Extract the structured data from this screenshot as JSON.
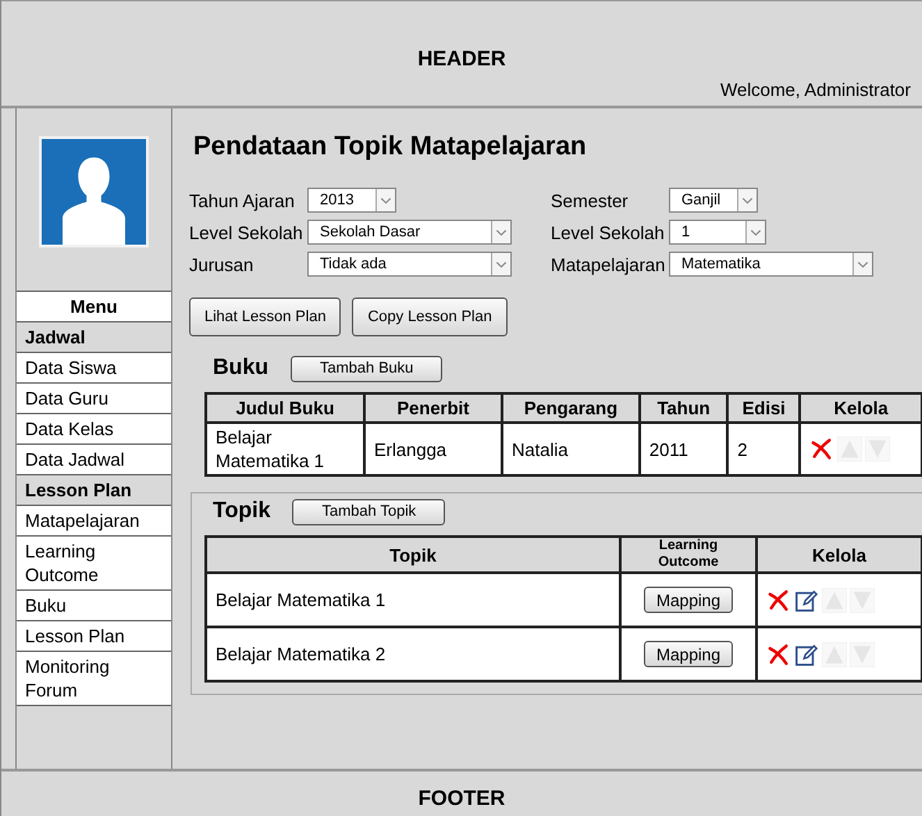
{
  "header": {
    "title": "HEADER",
    "welcome": "Welcome, Administrator"
  },
  "sidebar": {
    "menu": [
      {
        "kind": "title",
        "label": "Menu"
      },
      {
        "kind": "section",
        "label": "Jadwal"
      },
      {
        "kind": "item",
        "label": "Data Siswa"
      },
      {
        "kind": "item",
        "label": "Data Guru"
      },
      {
        "kind": "item",
        "label": "Data Kelas"
      },
      {
        "kind": "item",
        "label": "Data Jadwal"
      },
      {
        "kind": "section",
        "label": "Lesson Plan"
      },
      {
        "kind": "item",
        "label": "Matapelajaran"
      },
      {
        "kind": "item",
        "label": "Learning Outcome"
      },
      {
        "kind": "item",
        "label": "Buku"
      },
      {
        "kind": "item",
        "label": "Lesson Plan"
      },
      {
        "kind": "item",
        "label": "Monitoring Forum"
      }
    ]
  },
  "page_title": "Pendataan Topik Matapelajaran",
  "form": {
    "columns": [
      [
        {
          "label": "Tahun Ajaran",
          "value": "2013"
        },
        {
          "label": "Level Sekolah",
          "value": "Sekolah Dasar"
        },
        {
          "label": "Jurusan",
          "value": "Tidak ada"
        }
      ],
      [
        {
          "label": "Semester",
          "value": "Ganjil"
        },
        {
          "label": "Level Sekolah",
          "value": "1"
        },
        {
          "label": "Matapelajaran",
          "value": "Matematika"
        }
      ]
    ],
    "buttons": [
      "Lihat Lesson Plan",
      "Copy Lesson Plan"
    ]
  },
  "buku": {
    "title": "Buku",
    "add_button": "Tambah Buku",
    "columns": [
      "Judul Buku",
      "Penerbit",
      "Pengarang",
      "Tahun",
      "Edisi",
      "Kelola"
    ],
    "rows": [
      {
        "cells": [
          "Belajar Matematika 1",
          "Erlangga",
          "Natalia",
          "2011",
          "2"
        ],
        "actions": [
          {
            "kind": "delete",
            "disabled": false
          },
          {
            "kind": "up",
            "disabled": true
          },
          {
            "kind": "down",
            "disabled": true
          }
        ]
      }
    ]
  },
  "topik": {
    "title": "Topik",
    "add_button": "Tambah Topik",
    "columns": [
      "Topik",
      "Learning Outcome",
      "Kelola"
    ],
    "rows": [
      {
        "topik": "Belajar Matematika 1",
        "button": "Mapping",
        "actions": [
          {
            "kind": "delete",
            "disabled": false
          },
          {
            "kind": "edit",
            "disabled": false
          },
          {
            "kind": "up",
            "disabled": true
          },
          {
            "kind": "down",
            "disabled": true
          }
        ]
      },
      {
        "topik": "Belajar Matematika 2",
        "button": "Mapping",
        "actions": [
          {
            "kind": "delete",
            "disabled": false
          },
          {
            "kind": "edit",
            "disabled": false
          },
          {
            "kind": "up",
            "disabled": true
          },
          {
            "kind": "down",
            "disabled": true
          }
        ]
      }
    ]
  },
  "footer": {
    "title": "FOOTER"
  }
}
